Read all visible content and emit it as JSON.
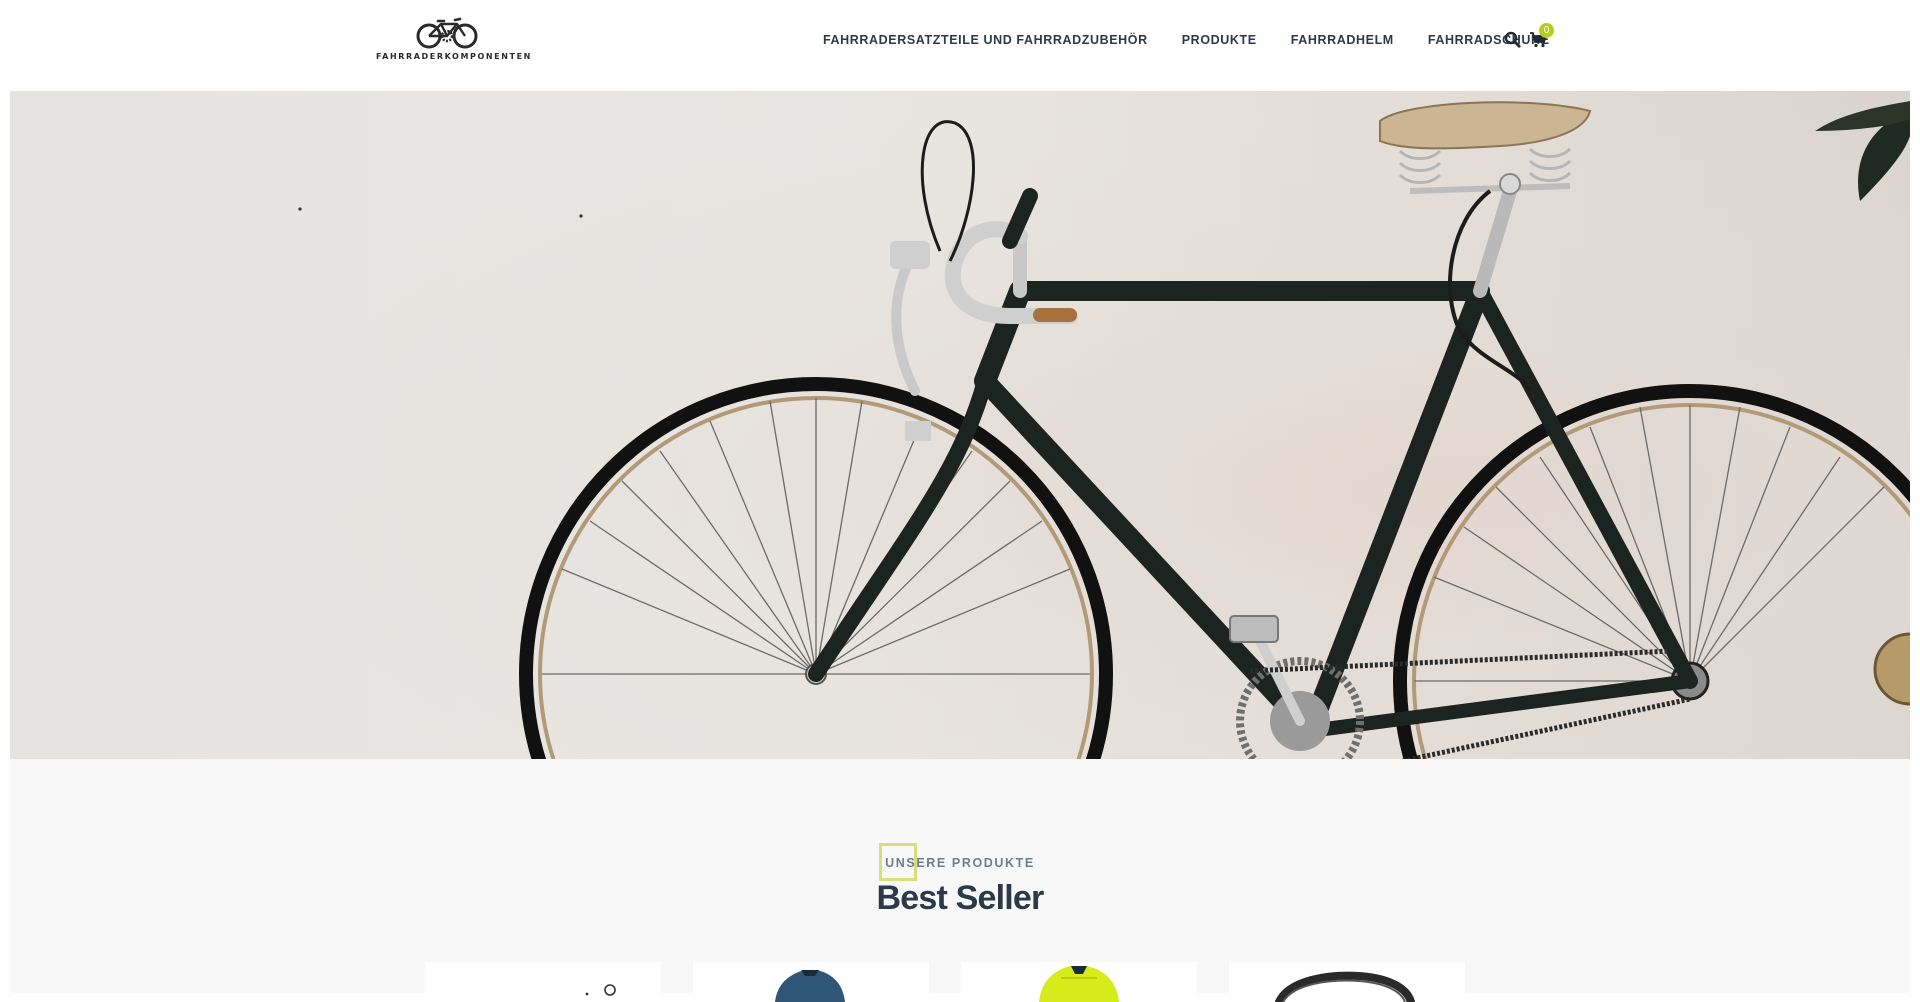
{
  "brand": {
    "logo_text": "FAHRRADERKOMPONENTEN",
    "logo_icon": "bicycle-gear-icon"
  },
  "nav": {
    "items": [
      {
        "label": "FAHRRADERSATZTEILE UND FAHRRADZUBEHÖR"
      },
      {
        "label": "PRODUKTE"
      },
      {
        "label": "FAHRRADHELM"
      },
      {
        "label": "FAHRRADSCHUHE"
      }
    ]
  },
  "header_actions": {
    "search_icon": "search-icon",
    "cart_icon": "cart-icon",
    "cart_count": "0"
  },
  "hero": {
    "image": "vintage bicycle leaning against a light wall"
  },
  "best_seller": {
    "eyebrow": "UNSERE PRODUKTE",
    "title": "Best Seller",
    "products": [
      {
        "image": "bicycle part"
      },
      {
        "image": "blue cycling jersey"
      },
      {
        "image": "neon yellow cycling jacket"
      },
      {
        "image": "black bike cable lock"
      }
    ]
  },
  "colors": {
    "accent": "#b7cc1e",
    "heading": "#2b3a48",
    "nav_text": "#2e3a46",
    "section_bg": "#f8f8f8"
  }
}
